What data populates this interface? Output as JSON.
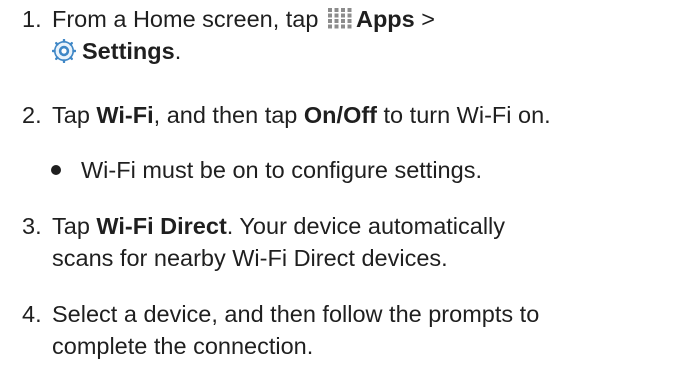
{
  "steps": [
    {
      "number": "1.",
      "parts": {
        "a": "From a Home screen, tap",
        "apps_icon": "apps-grid-icon",
        "apps": "Apps",
        "b": ">",
        "settings_icon": "settings-gear-icon",
        "settings": "Settings",
        "c": "."
      }
    },
    {
      "number": "2.",
      "parts": {
        "a": "Tap",
        "wifi": "Wi-Fi",
        "b": ", and then tap",
        "onoff": "On/Off",
        "c": "to turn Wi-Fi on."
      }
    },
    {
      "number": "3.",
      "parts": {
        "a": "Tap",
        "wifi_direct": "Wi-Fi Direct",
        "b": ". Your device automatically",
        "line2": "scans for nearby Wi-Fi Direct devices."
      }
    },
    {
      "number": "4.",
      "parts": {
        "line1": "Select a device, and then follow the prompts to",
        "line2": "complete the connection."
      }
    }
  ],
  "bullet": "Wi-Fi must be on to configure settings.",
  "colors": {
    "text": "#1f1f1f",
    "icon_blue": "#3f87c6",
    "icon_gray": "#8c8c8c"
  }
}
